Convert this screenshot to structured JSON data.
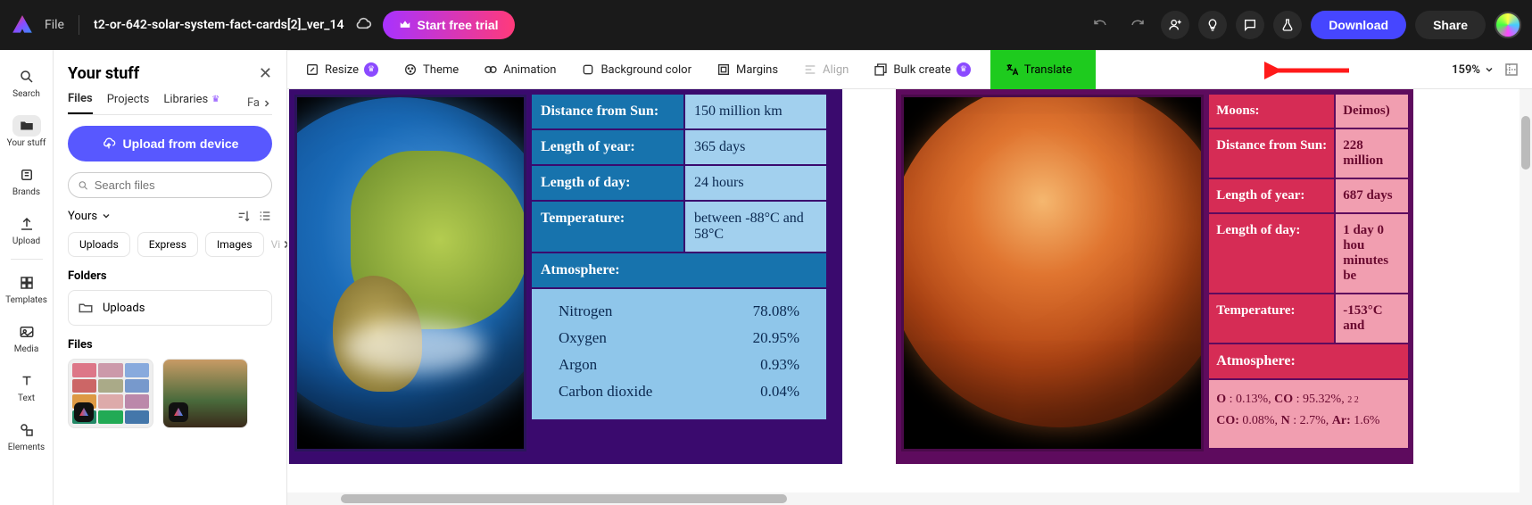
{
  "topbar": {
    "file_label": "File",
    "doc_title": "t2-or-642-solar-system-fact-cards[2]_ver_14",
    "trial_label": "Start free trial",
    "download_label": "Download",
    "share_label": "Share"
  },
  "rail": {
    "search": "Search",
    "your_stuff": "Your stuff",
    "brands": "Brands",
    "upload": "Upload",
    "templates": "Templates",
    "media": "Media",
    "text": "Text",
    "elements": "Elements"
  },
  "panel": {
    "title": "Your stuff",
    "tabs": {
      "files": "Files",
      "projects": "Projects",
      "libraries": "Libraries",
      "fav": "Fa"
    },
    "upload_label": "Upload from device",
    "search_placeholder": "Search files",
    "yours_label": "Yours",
    "chips": {
      "uploads": "Uploads",
      "express": "Express",
      "images": "Images",
      "vid": "Vi"
    },
    "folders_label": "Folders",
    "folder_name": "Uploads",
    "files_label": "Files"
  },
  "toolbar": {
    "resize": "Resize",
    "theme": "Theme",
    "animation": "Animation",
    "bgcolor": "Background color",
    "margins": "Margins",
    "align": "Align",
    "bulk": "Bulk create",
    "translate": "Translate",
    "zoom": "159%"
  },
  "earth": {
    "rows": {
      "dist_l": "Distance from Sun:",
      "dist_v": "150 million km",
      "year_l": "Length of year:",
      "year_v": "365 days",
      "day_l": "Length of day:",
      "day_v": "24 hours",
      "temp_l": "Temperature:",
      "temp_v": "between -88°C and 58°C",
      "atmo_header": "Atmosphere:"
    },
    "atmo": {
      "n_l": "Nitrogen",
      "n_v": "78.08%",
      "o_l": "Oxygen",
      "o_v": "20.95%",
      "a_l": "Argon",
      "a_v": "0.93%",
      "c_l": "Carbon dioxide",
      "c_v": "0.04%"
    }
  },
  "mars": {
    "rows": {
      "moons_l": "Moons:",
      "moons_v": "Deimos)",
      "dist_l": "Distance from Sun:",
      "dist_v": "228 million",
      "year_l": "Length of year:",
      "year_v": "687 days",
      "day_l": "Length of day:",
      "day_v": "1 day 0 hou minutes be",
      "temp_l": "Temperature:",
      "temp_v": "-153°C and",
      "atmo_header": "Atmosphere:"
    },
    "atmo_line1": "O : 0.13%, CO : 95.32%, 2 2",
    "atmo_line2": "CO: 0.08%, N : 2.7%, Ar: 1.6%"
  },
  "chart_data": [
    {
      "type": "table",
      "title": "Earth fact card (partial)",
      "rows": [
        {
          "label": "Distance from Sun",
          "value": "150 million km"
        },
        {
          "label": "Length of year",
          "value": "365 days"
        },
        {
          "label": "Length of day",
          "value": "24 hours"
        },
        {
          "label": "Temperature",
          "value": "between -88°C and 58°C"
        }
      ],
      "atmosphere": [
        {
          "gas": "Nitrogen",
          "percent": 78.08
        },
        {
          "gas": "Oxygen",
          "percent": 20.95
        },
        {
          "gas": "Argon",
          "percent": 0.93
        },
        {
          "gas": "Carbon dioxide",
          "percent": 0.04
        }
      ]
    },
    {
      "type": "table",
      "title": "Mars fact card (partial, cropped)",
      "rows": [
        {
          "label": "Moons",
          "value": "Deimos) (truncated)"
        },
        {
          "label": "Distance from Sun",
          "value": "228 million (truncated)"
        },
        {
          "label": "Length of year",
          "value": "687 days"
        },
        {
          "label": "Length of day",
          "value": "1 day 0 hou minutes be (truncated)"
        },
        {
          "label": "Temperature",
          "value": "-153°C and (truncated)"
        }
      ],
      "atmosphere_text": "O : 0.13%, CO : 95.32%, CO: 0.08%, N : 2.7%, Ar: 1.6% (truncated)"
    }
  ]
}
